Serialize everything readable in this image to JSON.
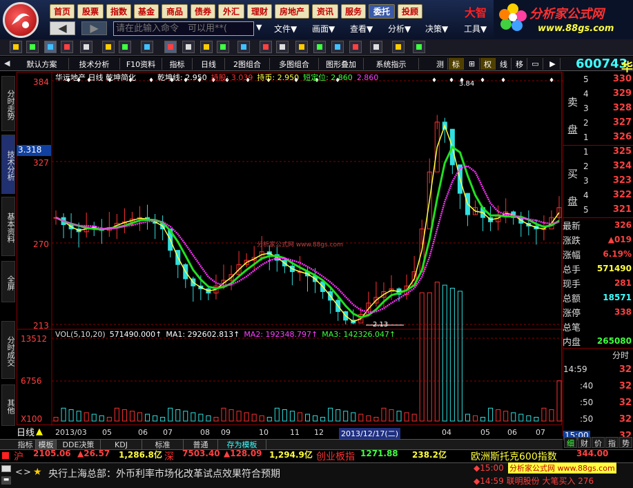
{
  "menu": [
    "首页",
    "股票",
    "指数",
    "基金",
    "商品",
    "债券",
    "外汇",
    "理财",
    "房地产",
    "资讯",
    "服务",
    "委托",
    "投顾"
  ],
  "brand": {
    "prefix": "大智",
    "name": "分析家公式网",
    "url": "www.88gs.com"
  },
  "command": {
    "placeholder": "请在此输入命令　可以用**("
  },
  "rmenu": [
    "文件▼",
    "画面▼",
    "查看▼",
    "分析▼",
    "决策▼",
    "工具▼"
  ],
  "tabs2": [
    "默认方案",
    "技术分析",
    "F10资料",
    "指标",
    "日线",
    "2图组合",
    "多图组合",
    "图形叠加",
    "系统指示"
  ],
  "tabs2r": [
    "测",
    "标",
    "⊞",
    "权",
    "线",
    "移",
    "▭",
    "▶"
  ],
  "stock": {
    "code": "600743",
    "name": "华",
    "price_label": "3.318"
  },
  "sidetabs": [
    "分时走势",
    "技术分析",
    "基本资料",
    "全屏",
    "分时成交",
    "其他"
  ],
  "chart": {
    "title": "华远地产 日线 乾坤简化",
    "legend": [
      {
        "t": "乾坤线: 2.950",
        "c": "#ffffff"
      },
      {
        "t": "持股: 3.039",
        "c": "#ff3030"
      },
      {
        "t": "持币: 2.950",
        "c": "#ffff40"
      },
      {
        "t": "短定位: 2.860",
        "c": "#40ff40"
      },
      {
        "t": "2.860",
        "c": "#ff40ff"
      }
    ],
    "yticks": [
      "384",
      "327",
      "270",
      "213"
    ],
    "peak_label": "3.84",
    "low_label": "2.13",
    "vol_legend": [
      {
        "t": "VOL(5,10,20)",
        "c": "#ddd"
      },
      {
        "t": "571490.000↑",
        "c": "#fff"
      },
      {
        "t": "MA1: 292602.813↑",
        "c": "#fff"
      },
      {
        "t": "MA2: 192348.797↑",
        "c": "#ff40ff"
      },
      {
        "t": "MA3: 142326.047↑",
        "c": "#40ff40"
      }
    ],
    "vol_yticks": [
      "13512",
      "6756",
      "X100"
    ],
    "months": [
      "2013/03",
      "05",
      "06",
      "07",
      "08",
      "09",
      "10",
      "11",
      "12",
      "2013/12/17(二)",
      "04",
      "05",
      "06",
      "07"
    ],
    "mode_label": "日线",
    "watermark": "分析家公式网 www.88gs.com"
  },
  "chart_data": {
    "type": "line",
    "ylim": [
      2.13,
      3.84
    ],
    "series": [
      {
        "values": [
          2.88,
          2.83,
          2.8,
          2.78,
          2.82,
          2.8,
          2.79,
          2.81,
          2.84,
          2.85,
          2.87,
          2.88,
          2.86,
          2.84,
          2.8,
          2.65,
          2.55,
          2.45,
          2.4,
          2.38,
          2.35,
          2.4,
          2.44,
          2.48,
          2.55,
          2.58,
          2.6,
          2.64,
          2.62,
          2.58,
          2.54,
          2.5,
          2.5,
          2.47,
          2.43,
          2.36,
          2.3,
          2.22,
          2.16,
          2.14,
          2.2,
          2.28,
          2.32,
          2.36,
          2.38,
          2.34,
          2.4,
          2.5,
          2.8,
          3.2,
          3.55,
          3.5,
          3.25,
          3.05,
          2.9,
          2.95,
          2.88,
          2.85,
          2.9,
          2.92,
          2.88,
          2.84,
          2.82,
          2.8,
          2.8,
          2.88,
          2.95
        ]
      }
    ]
  },
  "orderbook": {
    "sell_label": [
      "卖",
      "盘"
    ],
    "buy_label": [
      "买",
      "盘"
    ],
    "sell": [
      {
        "n": "5",
        "p": "330"
      },
      {
        "n": "4",
        "p": "329"
      },
      {
        "n": "3",
        "p": "328"
      },
      {
        "n": "2",
        "p": "327"
      },
      {
        "n": "1",
        "p": "326"
      }
    ],
    "buy": [
      {
        "n": "1",
        "p": "325"
      },
      {
        "n": "2",
        "p": "324"
      },
      {
        "n": "3",
        "p": "323"
      },
      {
        "n": "4",
        "p": "322"
      },
      {
        "n": "5",
        "p": "321"
      }
    ]
  },
  "stats": [
    {
      "l": "最新",
      "v": "326",
      "c": "#ff4040"
    },
    {
      "l": "涨跌",
      "v": "▲019",
      "c": "#ff4040"
    },
    {
      "l": "涨幅",
      "v": "6.19%",
      "c": "#ff4040"
    },
    {
      "l": "总手",
      "v": "571490",
      "c": "#ffff40"
    },
    {
      "l": "现手",
      "v": "281",
      "c": "#ff4040"
    },
    {
      "l": "总额",
      "v": "18571",
      "c": "#40ffff"
    },
    {
      "l": "涨停",
      "v": "338",
      "c": "#ff4040"
    },
    {
      "l": "总笔",
      "v": "",
      "c": "#ddd"
    },
    {
      "l": "内盘",
      "v": "265080",
      "c": "#40ff40"
    }
  ],
  "ticks": {
    "header": "分时",
    "rows": [
      {
        "t": "14:59",
        "v": "32"
      },
      {
        "t": ":40",
        "v": "32"
      },
      {
        "t": ":50",
        "v": "32"
      },
      {
        "t": ":50",
        "v": "32"
      },
      {
        "t": "15:00",
        "v": "32"
      }
    ],
    "tabs": [
      "细",
      "财",
      "价",
      "指",
      "势"
    ]
  },
  "bottomtabs": [
    "指标",
    "模板",
    "DDE决策",
    "KDJ",
    "标准",
    "普通",
    "存为模板"
  ],
  "ticker": [
    {
      "t": "沪",
      "c": "#ff3030"
    },
    {
      "t": "2105.06",
      "c": "#ff4040"
    },
    {
      "t": "▲26.57",
      "c": "#ff4040"
    },
    {
      "t": "1,286.8亿",
      "c": "#ffff40"
    },
    {
      "t": "深",
      "c": "#ff3030"
    },
    {
      "t": "7503.40",
      "c": "#ff4040"
    },
    {
      "t": "▲128.09",
      "c": "#ff4040"
    },
    {
      "t": "1,294.9亿",
      "c": "#ffff40"
    },
    {
      "t": "创业板指",
      "c": "#ff3030"
    },
    {
      "t": "1271.88",
      "c": "#40ff40"
    },
    {
      "t": "238.2亿",
      "c": "#ffff40"
    },
    {
      "t": "欧洲斯托克600指数",
      "c": "#ffff40"
    },
    {
      "t": "344.00",
      "c": "#ff4040"
    }
  ],
  "news": "央行上海总部：外币利率市场化改革试点效果符合预期",
  "alerts": [
    {
      "t": "◆15:00",
      "c": "#ff4040"
    },
    {
      "t": "分析家公式网 www.88gs.com",
      "c": "#c00000"
    },
    {
      "t": "◆14:59 联明股份 大笔买入 276",
      "c": "#ff4040"
    }
  ],
  "colors": {
    "green": "#20e020",
    "yellow": "#ffff40",
    "magenta": "#ff30ff",
    "up": "#ff3030",
    "down": "#30e0e0",
    "grid": "#8b0000"
  }
}
